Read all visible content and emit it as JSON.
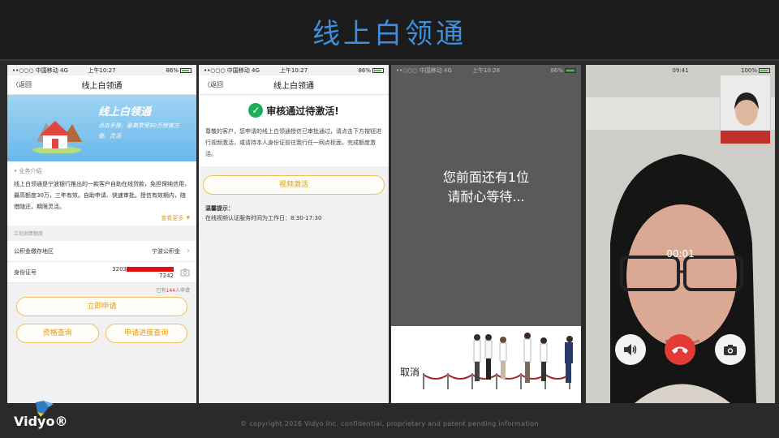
{
  "slide": {
    "title": "线上白领通",
    "copyright": "© copyright  2016 Vidyo Inc.  confidential,  proprietary  and patent pending  information",
    "logo_text": "Vidyo®"
  },
  "phone1": {
    "status": {
      "carrier": "••○○○ 中国移动  4G",
      "time": "上午10:27",
      "battery": "86%"
    },
    "nav": {
      "back": "〈返回",
      "title": "线上白领通"
    },
    "banner": {
      "title": "线上白领通",
      "subtitle": "点击手指，最高享受30万授信方便、灵活"
    },
    "intro_label": "• 业务介绍",
    "intro_text": "线上白领通是宁波银行推出的一款客户自助在线贷款，免担保纯信用，最高额度30万，三年有效。自助申请、快速审批。授信有效期内，随借随还，期限灵活。",
    "more_link": "查看更多",
    "group_label": "立划测算额度",
    "fund_region": {
      "label": "公积金缴存地区",
      "value": "宁波公积金"
    },
    "id_number": {
      "label": "身份证号",
      "prefix": "3203",
      "suffix": "7242"
    },
    "count_note": {
      "prefix": "已有",
      "num": "144",
      "suffix": "人申请"
    },
    "apply_button": "立即申请",
    "qualify_button": "资格查询",
    "progress_button": "申请进度查询"
  },
  "phone2": {
    "status": {
      "carrier": "••○○○ 中国移动  4G",
      "time": "上午10:27",
      "battery": "86%"
    },
    "nav": {
      "back": "〈返回",
      "title": "线上白领通"
    },
    "heading": "审核通过待激活!",
    "body": "尊敬的客户，您申请的线上白领通授信已审批通过，请点击下方按钮进行视频激活，或请持本人身份证前往我行任一网点柜面，完成额度激活。",
    "video_button": "视频激活",
    "tip_title": "温馨提示：",
    "tip_text": "在线视频认证服务时间为工作日：8:30-17:30"
  },
  "phone3": {
    "status": {
      "carrier": "••○○○ 中国移动  4G",
      "time": "上午10:28",
      "battery": "86%"
    },
    "wait_line1": "您前面还有1位",
    "wait_line2": "请耐心等待...",
    "cancel": "取消"
  },
  "phone4": {
    "status": {
      "time": "09:41",
      "battery": "100%"
    },
    "timer": "00:01"
  }
}
